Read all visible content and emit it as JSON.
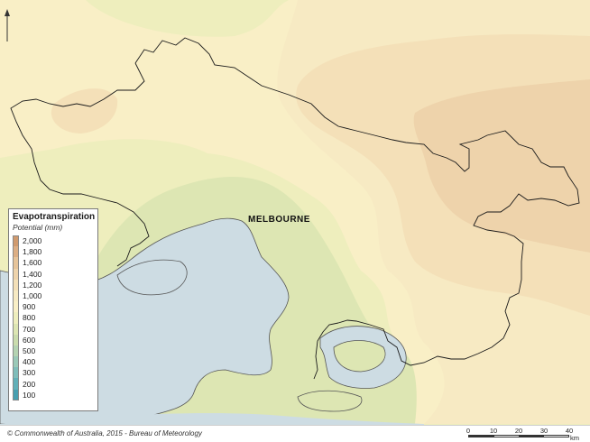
{
  "legend": {
    "title": "Evapotranspiration",
    "subtitle": "Potential (mm)",
    "classes": [
      {
        "label": "2,000",
        "color": "#d09a6e"
      },
      {
        "label": "1,800",
        "color": "#dcae84"
      },
      {
        "label": "1,600",
        "color": "#e6c49a"
      },
      {
        "label": "1,400",
        "color": "#eed3ab"
      },
      {
        "label": "1,200",
        "color": "#f4e0b8"
      },
      {
        "label": "1,000",
        "color": "#f7eac3"
      },
      {
        "label": "900",
        "color": "#f9efc6"
      },
      {
        "label": "800",
        "color": "#eeeebd"
      },
      {
        "label": "700",
        "color": "#dde6b3"
      },
      {
        "label": "600",
        "color": "#cadcad"
      },
      {
        "label": "500",
        "color": "#b4d3b2"
      },
      {
        "label": "400",
        "color": "#9ac9b8"
      },
      {
        "label": "300",
        "color": "#7fbdba"
      },
      {
        "label": "200",
        "color": "#62b0b8"
      },
      {
        "label": "100",
        "color": "#469fb0"
      }
    ]
  },
  "map": {
    "city_label": "MELBOURNE",
    "colors": {
      "water": "#cddce3",
      "zone_700": "#dde6b3",
      "zone_800": "#eeeebd",
      "zone_900": "#f9efc6",
      "zone_1000": "#f7eac3",
      "zone_1200": "#f4e0b8",
      "zone_1400": "#eed3ab",
      "boundary": "#1a1a1a"
    }
  },
  "footer": {
    "copyright": "© Commonwealth of Australia, 2015 - Bureau of Meteorology"
  },
  "scale_bar": {
    "ticks": [
      "0",
      "10",
      "20",
      "30",
      "40"
    ],
    "unit": "km"
  }
}
